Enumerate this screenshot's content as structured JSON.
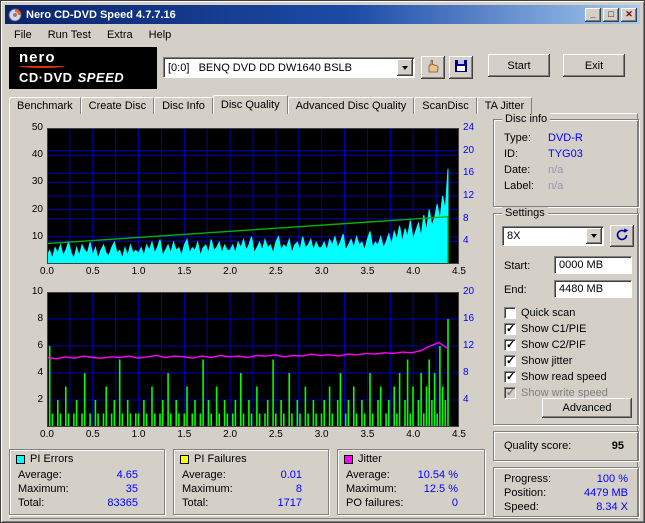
{
  "window": {
    "title": "Nero CD-DVD Speed 4.7.7.16",
    "controls": {
      "minimize": "_",
      "maximize": "□",
      "close": "✕"
    }
  },
  "menu": {
    "items": [
      "File",
      "Run Test",
      "Extra",
      "Help"
    ]
  },
  "toolbar": {
    "logo": {
      "line1": "nero",
      "line2": "CD·DVD",
      "line3": "SPEED"
    },
    "drive_select": "[0:0]   BENQ DVD DD DW1640 BSLB",
    "start_label": "Start",
    "exit_label": "Exit"
  },
  "tabs": {
    "items": [
      "Benchmark",
      "Create Disc",
      "Disc Info",
      "Disc Quality",
      "Advanced Disc Quality",
      "ScanDisc",
      "TA Jitter"
    ],
    "active": "Disc Quality"
  },
  "disc_info": {
    "title": "Disc info",
    "rows": [
      {
        "label": "Type:",
        "value": "DVD-R"
      },
      {
        "label": "ID:",
        "value": "TYG03"
      },
      {
        "label": "Date:",
        "value": "n/a"
      },
      {
        "label": "Label:",
        "value": "n/a"
      }
    ]
  },
  "settings": {
    "title": "Settings",
    "speed": "8X",
    "start_label": "Start:",
    "start_value": "0000 MB",
    "end_label": "End:",
    "end_value": "4480 MB",
    "checkboxes": [
      {
        "label": "Quick scan",
        "checked": false,
        "enabled": true
      },
      {
        "label": "Show C1/PIE",
        "checked": true,
        "enabled": true
      },
      {
        "label": "Show C2/PIF",
        "checked": true,
        "enabled": true
      },
      {
        "label": "Show jitter",
        "checked": true,
        "enabled": true
      },
      {
        "label": "Show read speed",
        "checked": true,
        "enabled": true
      },
      {
        "label": "Show write speed",
        "checked": true,
        "enabled": false
      }
    ],
    "advanced_label": "Advanced"
  },
  "quality": {
    "label": "Quality score:",
    "value": "95"
  },
  "progress": {
    "rows": [
      {
        "label": "Progress:",
        "value": "100 %"
      },
      {
        "label": "Position:",
        "value": "4479 MB"
      },
      {
        "label": "Speed:",
        "value": "8.34 X"
      }
    ]
  },
  "stats": {
    "pi_errors": {
      "title": "PI Errors",
      "swatch": "#00ffff",
      "rows": [
        [
          "Average:",
          "4.65"
        ],
        [
          "Maximum:",
          "35"
        ],
        [
          "Total:",
          "83365"
        ]
      ]
    },
    "pi_failures": {
      "title": "PI Failures",
      "swatch": "#ffff00",
      "rows": [
        [
          "Average:",
          "0.01"
        ],
        [
          "Maximum:",
          "8"
        ],
        [
          "Total:",
          "1717"
        ]
      ]
    },
    "jitter": {
      "title": "Jitter",
      "swatch": "#ff00ff",
      "rows": [
        [
          "Average:",
          "10.54 %"
        ],
        [
          "Maximum:",
          "12.5 %"
        ],
        [
          "PO failures:",
          "0"
        ]
      ]
    }
  },
  "chart_data": [
    {
      "type": "area",
      "name": "pi-errors-chart",
      "x_min": 0,
      "x_max": 4.5,
      "x_ticks": [
        "0.0",
        "0.5",
        "1.0",
        "1.5",
        "2.0",
        "2.5",
        "3.0",
        "3.5",
        "4.0",
        "4.5"
      ],
      "y_left": {
        "max": 50,
        "ticks": [
          50,
          40,
          30,
          20,
          10
        ]
      },
      "y_right": {
        "max": 24,
        "ticks": [
          24,
          20,
          16,
          12,
          8,
          4
        ]
      },
      "series": [
        {
          "name": "PI Errors",
          "color": "#00ffff",
          "style": "area",
          "axis": "left",
          "x_end": 4.38,
          "values": [
            3,
            5,
            2,
            6,
            4,
            7,
            3,
            5,
            8,
            4,
            2,
            6,
            3,
            7,
            5,
            4,
            8,
            3,
            6,
            2,
            5,
            7,
            4,
            3,
            6,
            8,
            4,
            5,
            2,
            6,
            3,
            7,
            4,
            5,
            4,
            6,
            3,
            7,
            5,
            8,
            4,
            6,
            9,
            3,
            5,
            7,
            4,
            8,
            5,
            6,
            3,
            7,
            9,
            4,
            6,
            5,
            8,
            3,
            6,
            7,
            4,
            9,
            5,
            6,
            8,
            4,
            7,
            5,
            5,
            7,
            4,
            8,
            6,
            9,
            5,
            7,
            10,
            4,
            6,
            8,
            5,
            9,
            6,
            7,
            4,
            8,
            10,
            5,
            7,
            6,
            9,
            4,
            7,
            8,
            5,
            10,
            6,
            7,
            9,
            5,
            8,
            6,
            6,
            8,
            5,
            9,
            7,
            10,
            6,
            8,
            11,
            5,
            7,
            9,
            6,
            10,
            7,
            8,
            5,
            9,
            12,
            6,
            8,
            7,
            10,
            6,
            8,
            11,
            7,
            12,
            9,
            14,
            8,
            13,
            10,
            16,
            9,
            12,
            15,
            10,
            18,
            12,
            20,
            14,
            17,
            22,
            16,
            25,
            20,
            35
          ]
        },
        {
          "name": "Read speed",
          "color": "#00b400",
          "style": "line",
          "axis": "right",
          "x_end": 4.38,
          "drop_end": true,
          "values": [
            3.6,
            8.34
          ]
        }
      ]
    },
    {
      "type": "line",
      "name": "pi-failures-jitter-chart",
      "x_min": 0,
      "x_max": 4.5,
      "x_ticks": [
        "0.0",
        "0.5",
        "1.0",
        "1.5",
        "2.0",
        "2.5",
        "3.0",
        "3.5",
        "4.0",
        "4.5"
      ],
      "y_left": {
        "max": 10,
        "ticks": [
          10,
          8,
          6,
          4,
          2
        ]
      },
      "y_right": {
        "max": 20,
        "ticks": [
          20,
          16,
          12,
          8,
          4
        ]
      },
      "series": [
        {
          "name": "PI Failures",
          "color": "#00ff00",
          "style": "bars",
          "axis": "left",
          "x_end": 4.38,
          "values": [
            0,
            6,
            1,
            0,
            2,
            1,
            0,
            3,
            1,
            0,
            1,
            2,
            0,
            1,
            4,
            0,
            1,
            0,
            2,
            1,
            0,
            1,
            3,
            0,
            1,
            2,
            0,
            5,
            1,
            0,
            2,
            1,
            0,
            1,
            1,
            0,
            2,
            1,
            0,
            3,
            1,
            0,
            1,
            2,
            0,
            4,
            1,
            0,
            2,
            1,
            0,
            1,
            3,
            0,
            1,
            2,
            0,
            1,
            5,
            0,
            2,
            1,
            0,
            3,
            1,
            0,
            2,
            1,
            0,
            1,
            2,
            0,
            4,
            1,
            0,
            2,
            1,
            0,
            3,
            1,
            0,
            1,
            2,
            0,
            5,
            1,
            0,
            2,
            1,
            0,
            4,
            1,
            0,
            2,
            1,
            0,
            3,
            1,
            0,
            2,
            1,
            0,
            1,
            2,
            0,
            3,
            1,
            0,
            2,
            4,
            0,
            1,
            2,
            0,
            3,
            1,
            0,
            2,
            1,
            0,
            4,
            1,
            0,
            2,
            3,
            0,
            1,
            2,
            0,
            3,
            1,
            4,
            0,
            2,
            5,
            1,
            3,
            0,
            2,
            4,
            1,
            3,
            5,
            2,
            4,
            1,
            6,
            3,
            2,
            8
          ]
        },
        {
          "name": "Jitter",
          "color": "#ff00ff",
          "style": "line",
          "axis": "right",
          "x_end": 4.38,
          "values": [
            10.3,
            10.1,
            10.4,
            10.2,
            10.5,
            10.3,
            10.2,
            10.4,
            10.3,
            10.5,
            10.2,
            10.4,
            10.6,
            10.3,
            10.5,
            10.4,
            10.2,
            10.5,
            10.3,
            10.6,
            10.4,
            10.5,
            10.3,
            10.6,
            10.5,
            10.7,
            10.4,
            10.6,
            10.5,
            10.8,
            10.6,
            10.7,
            10.5,
            10.8,
            10.7,
            10.9,
            10.8,
            11.0,
            10.9,
            11.1,
            11.0,
            11.3,
            12.0,
            12.5,
            11.6
          ]
        }
      ]
    }
  ]
}
